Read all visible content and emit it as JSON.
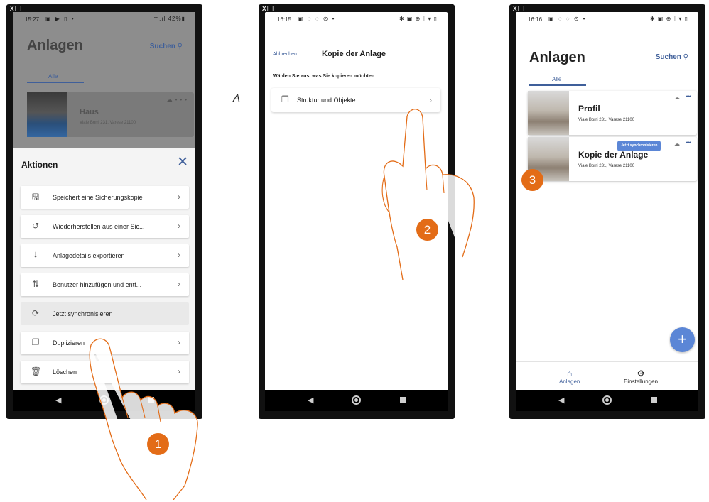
{
  "phone1": {
    "corner": "X☐",
    "status": {
      "time": "15:27",
      "battery": "42%"
    },
    "title": "Anlagen",
    "search_label": "Suchen",
    "tab_all": "Alle",
    "site": {
      "name": "Haus",
      "address": "Viale Borri 231, Varese 21100"
    },
    "sheet_title": "Aktionen",
    "actions": [
      {
        "label": "Speichert eine Sicherungskopie",
        "icon": "save-icon"
      },
      {
        "label": "Wiederherstellen aus einer Sic...",
        "icon": "restore-icon"
      },
      {
        "label": "Anlagedetails exportieren",
        "icon": "export-icon"
      },
      {
        "label": "Benutzer hinzufügen und entf...",
        "icon": "users-arrows-icon"
      },
      {
        "label": "Jetzt synchronisieren",
        "icon": "sync-icon",
        "disabled": true
      },
      {
        "label": "Duplizieren",
        "icon": "duplicate-icon"
      },
      {
        "label": "Löschen",
        "icon": "trash-icon"
      }
    ]
  },
  "phone2": {
    "corner": "X☐",
    "status": {
      "time": "16:15"
    },
    "cancel_label": "Abbrechen",
    "title": "Kopie der Anlage",
    "subtitle": "Wählen Sie aus, was Sie kopieren möchten",
    "option_label": "Struktur und Objekte"
  },
  "phone3": {
    "corner": "X☐",
    "status": {
      "time": "16:16"
    },
    "title": "Anlagen",
    "search_label": "Suchen",
    "tab_all": "Alle",
    "sites": [
      {
        "name": "Profil",
        "address": "Viale Borri 231, Varese 21100"
      },
      {
        "name": "Kopie der Anlage",
        "address": "Viale Borri 231, Varese 21100"
      }
    ],
    "sync_badge": "Jetzt synchronisieren",
    "nav": {
      "home_label": "Anlagen",
      "settings_label": "Einstellungen"
    }
  },
  "annotations": {
    "label_a": "A",
    "steps": [
      "1",
      "2",
      "3"
    ]
  },
  "colors": {
    "accent": "#3f5f9a",
    "fab": "#5b86d6",
    "step_badge": "#e36c17",
    "hand_stroke": "#e36c17"
  }
}
